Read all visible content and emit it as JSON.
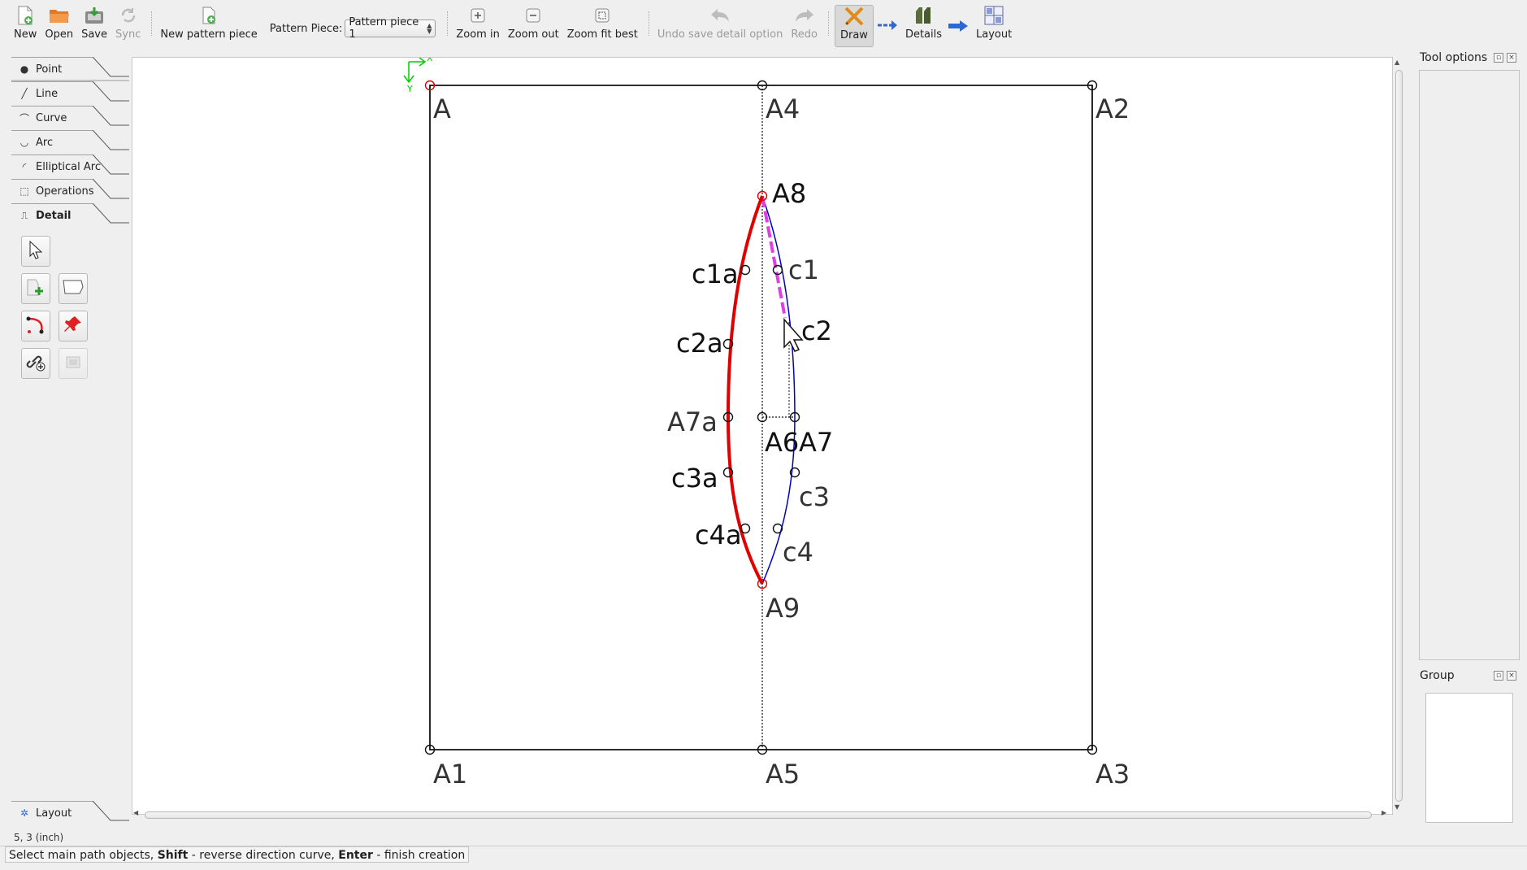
{
  "toolbar": {
    "new_label": "New",
    "open_label": "Open",
    "save_label": "Save",
    "sync_label": "Sync",
    "new_piece_label": "New pattern piece",
    "pattern_piece_label": "Pattern Piece:",
    "pattern_piece_value": "Pattern piece 1",
    "zoom_in_label": "Zoom in",
    "zoom_out_label": "Zoom out",
    "zoom_fit_label": "Zoom fit best",
    "undo_label": "Undo save detail option",
    "redo_label": "Redo",
    "draw_label": "Draw",
    "details_label": "Details",
    "layout_label": "Layout"
  },
  "left_panel": {
    "tabs": [
      {
        "label": "Point",
        "icon": "point-icon"
      },
      {
        "label": "Line",
        "icon": "line-icon"
      },
      {
        "label": "Curve",
        "icon": "curve-icon"
      },
      {
        "label": "Arc",
        "icon": "arc-icon"
      },
      {
        "label": "Elliptical Arc",
        "icon": "elliptical-arc-icon"
      },
      {
        "label": "Operations",
        "icon": "operations-icon"
      },
      {
        "label": "Detail",
        "icon": "detail-icon"
      }
    ],
    "active_tab": "Detail",
    "layout_tab": "Layout"
  },
  "canvas": {
    "axis_x": "X",
    "axis_y": "Y",
    "points": {
      "A": "A",
      "A1": "A1",
      "A2": "A2",
      "A3": "A3",
      "A4": "A4",
      "A5": "A5",
      "A6": "A6",
      "A7": "A7",
      "A7a": "A7a",
      "A8": "A8",
      "A9": "A9",
      "c1": "c1",
      "c2": "c2",
      "c3": "c3",
      "c4": "c4",
      "c1a": "c1a",
      "c2a": "c2a",
      "c3a": "c3a",
      "c4a": "c4a"
    },
    "colors": {
      "selected_path": "#e00000",
      "curve": "#0000cc",
      "dashed_highlight": "#e040e0",
      "axis": "#00cc00"
    }
  },
  "right_panel": {
    "tool_options_title": "Tool options",
    "group_title": "Group"
  },
  "status": {
    "coords": "5, 3 (inch)",
    "message_part1": "Select main path objects, ",
    "message_key1": "Shift",
    "message_part2": " - reverse direction curve, ",
    "message_key2": "Enter",
    "message_part3": " - finish creation"
  }
}
